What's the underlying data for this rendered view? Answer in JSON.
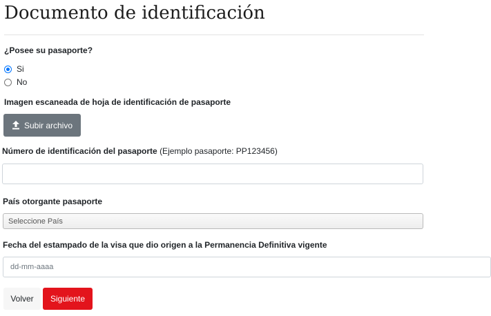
{
  "page": {
    "title": "Documento de identificación"
  },
  "passport_question": {
    "label": "¿Posee su pasaporte?",
    "options": [
      "Si",
      "No"
    ],
    "selected": "Si"
  },
  "upload": {
    "label": "Imagen escaneada de hoja de identificación de pasaporte",
    "button_label": "Subir archivo",
    "icon": "upload-icon"
  },
  "passport_number": {
    "label": "Número de identificación del pasaporte",
    "hint": "(Ejemplo pasaporte: PP123456)",
    "value": ""
  },
  "issuing_country": {
    "label": "País otorgante pasaporte",
    "selected": "Seleccione País"
  },
  "visa_date": {
    "label": "Fecha del estampado de la visa que dio origen a la Permanencia Definitiva vigente",
    "placeholder": "dd-mm-aaaa",
    "value": ""
  },
  "actions": {
    "back_label": "Volver",
    "next_label": "Siguiente"
  },
  "colors": {
    "primary_button": "#e3141c",
    "upload_button": "#6c757d",
    "radio_accent": "#0075ff"
  }
}
